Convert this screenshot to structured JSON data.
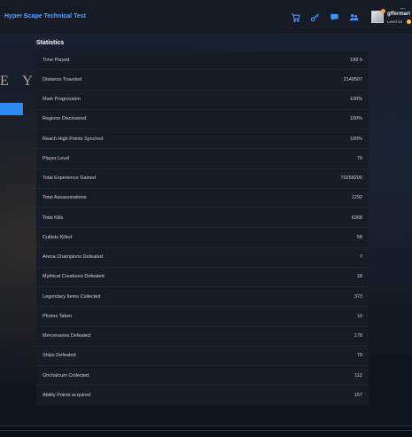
{
  "window": {
    "minimize_glyph": "_"
  },
  "header": {
    "title": "Hyper Scape Technical Test",
    "icons": [
      "cart-icon",
      "key-icon",
      "chat-icon",
      "friends-icon"
    ],
    "user": {
      "name": "gffermari",
      "level": "Level 23"
    }
  },
  "background": {
    "partial_text": "E Y"
  },
  "statistics": {
    "title": "Statistics",
    "rows": [
      {
        "label": "Time Played",
        "value": "199 h"
      },
      {
        "label": "Distance Traveled",
        "value": "2149507"
      },
      {
        "label": "Main Progression",
        "value": "100%"
      },
      {
        "label": "Regions Discovered",
        "value": "100%"
      },
      {
        "label": "Reach High Points Synched",
        "value": "100%"
      },
      {
        "label": "Player Level",
        "value": "79"
      },
      {
        "label": "Total Experience Gained",
        "value": "70258200"
      },
      {
        "label": "Total Assassinations",
        "value": "1292"
      },
      {
        "label": "Total Kills",
        "value": "6368"
      },
      {
        "label": "Cultists Killed",
        "value": "58"
      },
      {
        "label": "Arena Champions Defeated",
        "value": "7"
      },
      {
        "label": "Mythical Creatures Defeated",
        "value": "18"
      },
      {
        "label": "Legendary Items Collected",
        "value": "373"
      },
      {
        "label": "Photos Taken",
        "value": "10"
      },
      {
        "label": "Mercenaries Defeated",
        "value": "178"
      },
      {
        "label": "Ships Defeated",
        "value": "79"
      },
      {
        "label": "Orichalcum Collected",
        "value": "112"
      },
      {
        "label": "Ability Points acquired",
        "value": "157"
      }
    ]
  },
  "colors": {
    "accent": "#3d9bff",
    "title_blue": "#4fa3ff",
    "panel": "#171c26",
    "badge": "#f5a623"
  }
}
